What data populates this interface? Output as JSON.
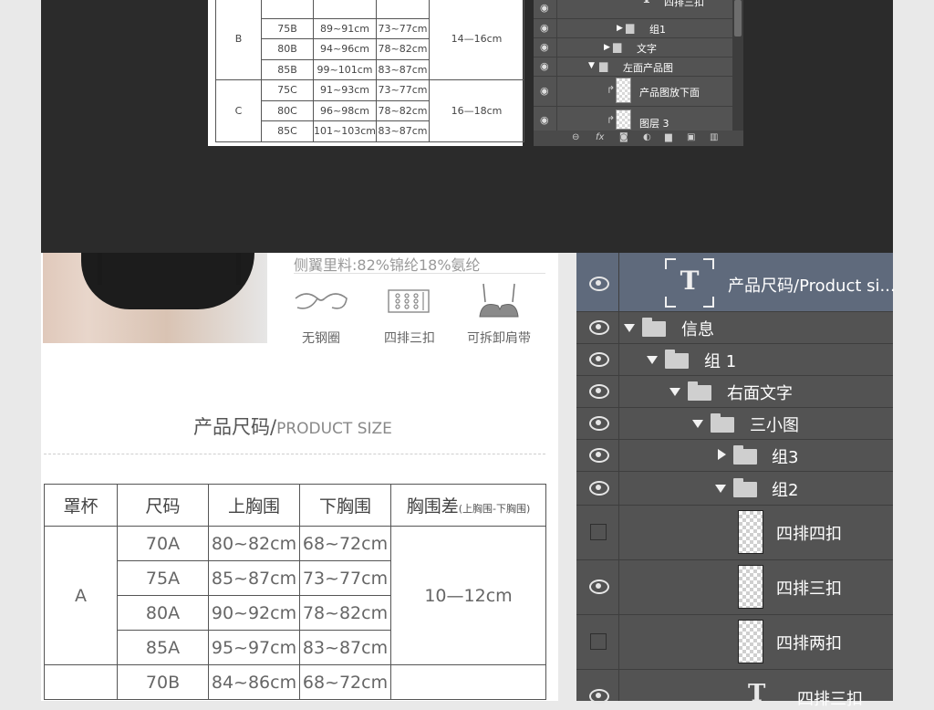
{
  "mini_table": {
    "rows": [
      {
        "cup": "",
        "size": "",
        "over": "",
        "under": "",
        "diff": ""
      },
      {
        "cup": "B",
        "size": "75B",
        "over": "89~91cm",
        "under": "73~77cm",
        "diff": "14—16cm"
      },
      {
        "size": "80B",
        "over": "94~96cm",
        "under": "78~82cm"
      },
      {
        "size": "85B",
        "over": "99~101cm",
        "under": "83~87cm"
      },
      {
        "cup": "C",
        "size": "75C",
        "over": "91~93cm",
        "under": "73~77cm",
        "diff": "16—18cm"
      },
      {
        "size": "80C",
        "over": "96~98cm",
        "under": "78~82cm"
      },
      {
        "size": "85C",
        "over": "101~103cm",
        "under": "83~87cm"
      }
    ]
  },
  "mini_layers": {
    "items": [
      {
        "label": "四排三扣",
        "kind": "text"
      },
      {
        "label": "组1",
        "kind": "folder-collapsed"
      },
      {
        "label": "文字",
        "kind": "folder-collapsed"
      },
      {
        "label": "左面产品图",
        "kind": "folder-open"
      },
      {
        "label": "产品图放下面",
        "kind": "image"
      },
      {
        "label": "图层 3",
        "kind": "image"
      }
    ],
    "footer_icons": [
      "link-icon",
      "fx-icon",
      "mask-icon",
      "adjustment-icon",
      "folder-icon",
      "new-layer-icon",
      "trash-icon"
    ],
    "footer_fx": "fx"
  },
  "product": {
    "fabric": "侧翼里料:82%锦纶18%氨纶",
    "features": [
      {
        "label": "无钢圈"
      },
      {
        "label": "四排三扣"
      },
      {
        "label": "可拆卸肩带"
      }
    ],
    "size_title_cn": "产品尺码/",
    "size_title_en": "PRODUCT SIZE"
  },
  "size_table": {
    "headers": {
      "cup": "罩杯",
      "size": "尺码",
      "over": "上胸围",
      "under": "下胸围",
      "diff": "胸围差",
      "diff_note": "(上胸围-下胸围)"
    },
    "rows": [
      {
        "cup": "A",
        "size": "70A",
        "over": "80~82cm",
        "under": "68~72cm",
        "diff": "10—12cm"
      },
      {
        "size": "75A",
        "over": "85~87cm",
        "under": "73~77cm"
      },
      {
        "size": "80A",
        "over": "90~92cm",
        "under": "78~82cm"
      },
      {
        "size": "85A",
        "over": "95~97cm",
        "under": "83~87cm"
      },
      {
        "size": "70B",
        "over": "84~86cm",
        "under": "68~72cm"
      }
    ]
  },
  "layers": {
    "items": [
      {
        "label": "产品尺码/Product si...",
        "kind": "text",
        "visible": true,
        "selected": true
      },
      {
        "label": "信息",
        "kind": "folder-open",
        "visible": true
      },
      {
        "label": "组 1",
        "kind": "folder-open",
        "visible": true
      },
      {
        "label": "右面文字",
        "kind": "folder-open",
        "visible": true
      },
      {
        "label": "三小图",
        "kind": "folder-open",
        "visible": true
      },
      {
        "label": "组3",
        "kind": "folder-collapsed",
        "visible": true
      },
      {
        "label": "组2",
        "kind": "folder-open",
        "visible": true
      },
      {
        "label": "四排四扣",
        "kind": "image",
        "visible": false
      },
      {
        "label": "四排三扣",
        "kind": "image",
        "visible": true
      },
      {
        "label": "四排两扣",
        "kind": "image",
        "visible": false
      },
      {
        "label": "四排三扣",
        "kind": "text",
        "visible": true
      }
    ]
  },
  "colors": {
    "panel_bg": "#535353",
    "selected_row": "#5f6a7c",
    "background_dark": "#2b2b2b"
  }
}
